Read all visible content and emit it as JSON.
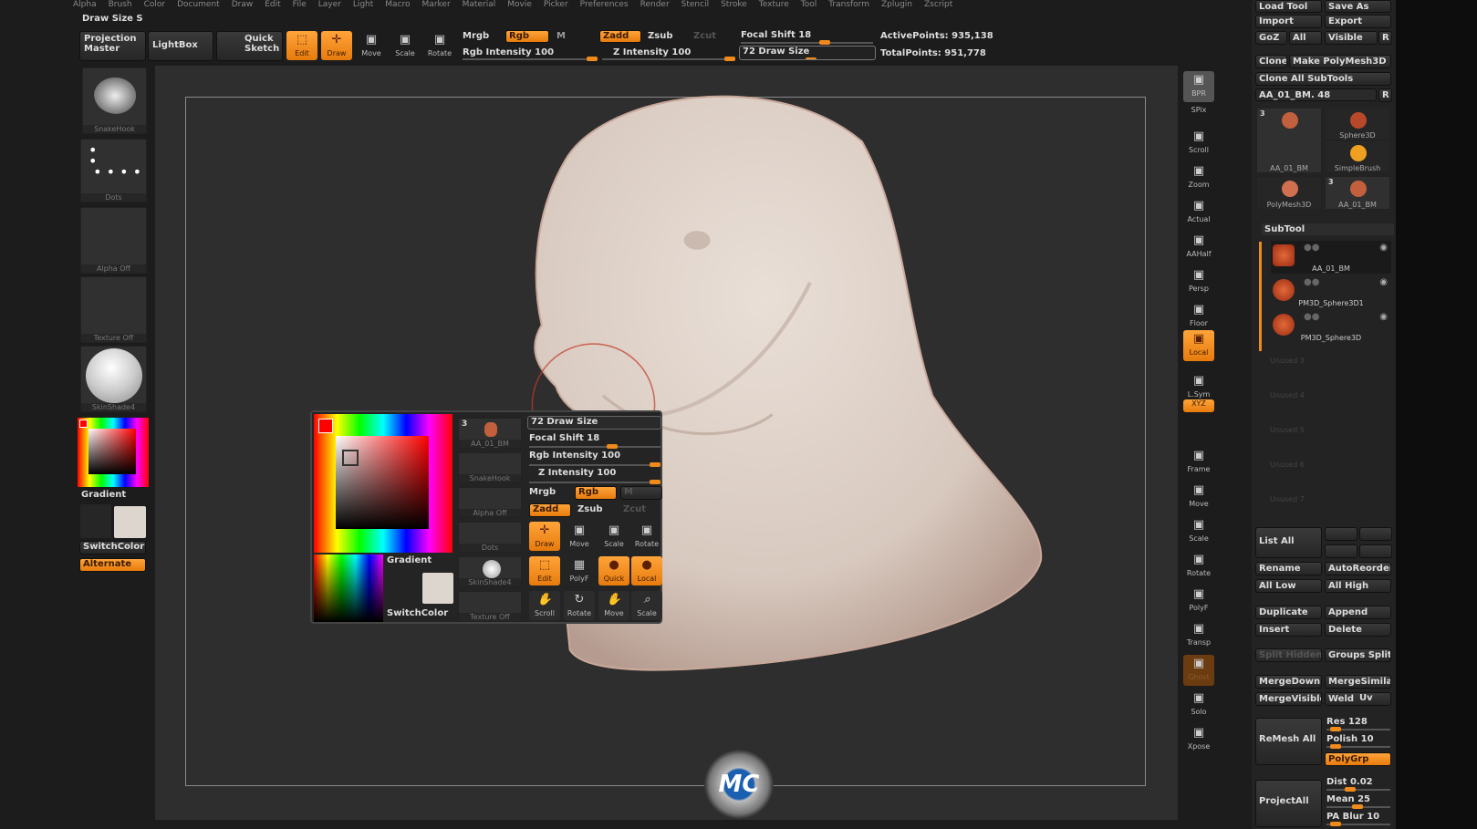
{
  "menu": [
    "Alpha",
    "Brush",
    "Color",
    "Document",
    "Draw",
    "Edit",
    "File",
    "Layer",
    "Light",
    "Macro",
    "Marker",
    "Material",
    "Movie",
    "Picker",
    "Preferences",
    "Render",
    "Stencil",
    "Stroke",
    "Texture",
    "Tool",
    "Transform",
    "Zplugin",
    "Zscript"
  ],
  "status": "Draw Size  S",
  "toolbar": {
    "projection_master": "Projection Master",
    "lightbox": "LightBox",
    "quick_sketch": "Quick Sketch",
    "edit": "Edit",
    "draw": "Draw",
    "move": "Move",
    "scale": "Scale",
    "rotate": "Rotate",
    "mrgb": "Mrgb",
    "rgb": "Rgb",
    "m": "M",
    "zadd": "Zadd",
    "zsub": "Zsub",
    "zcut": "Zcut",
    "rgb_intensity": "Rgb Intensity 100",
    "z_intensity": "Z Intensity 100",
    "focal_shift": "Focal Shift 18",
    "draw_size": "72 Draw Size",
    "active_points": "ActivePoints: 935,138",
    "total_points": "TotalPoints: 951,778"
  },
  "sliders": {
    "rgb_intensity": 100,
    "z_intensity": 100,
    "focal_shift": 18,
    "draw_size": 72
  },
  "left_shelf": {
    "brush": "SnakeHook",
    "stroke": "Dots",
    "alpha": "Alpha Off",
    "texture": "Texture Off",
    "material": "SkinShade4",
    "gradient": "Gradient",
    "switchcolor": "SwitchColor",
    "alternate": "Alternate"
  },
  "popup": {
    "tool": "AA_01_BM",
    "tool_count": "3",
    "brush": "SnakeHook",
    "alpha": "Alpha Off",
    "stroke": "Dots",
    "material": "SkinShade4",
    "texture": "Texture Off",
    "gradient": "Gradient",
    "switchcolor": "SwitchColor",
    "draw_size": "72 Draw Size",
    "focal_shift": "Focal Shift 18",
    "rgb_intensity": "Rgb Intensity 100",
    "z_intensity": "Z Intensity 100",
    "mrgb": "Mrgb",
    "rgb": "Rgb",
    "m": "M",
    "zadd": "Zadd",
    "zsub": "Zsub",
    "zcut": "Zcut",
    "draw": "Draw",
    "move": "Move",
    "scale": "Scale",
    "rotate": "Rotate",
    "edit": "Edit",
    "polyf": "PolyF",
    "quick": "Quick",
    "local": "Local",
    "scroll": "Scroll",
    "rotate2": "Rotate",
    "move2": "Move",
    "scale2": "Scale"
  },
  "right_shelf": [
    "BPR",
    "SPix",
    "Scroll",
    "Zoom",
    "Actual",
    "AAHalf",
    "Persp",
    "Floor",
    "Local",
    "L.Sym",
    "XYZ",
    "Frame",
    "Move",
    "Scale",
    "Rotate",
    "PolyF",
    "Transp",
    "Ghost",
    "Solo",
    "Xpose"
  ],
  "tool_panel": {
    "load_tool": "Load Tool",
    "save_as": "Save As",
    "import": "Import",
    "export": "Export",
    "goz": "GoZ",
    "all": "All",
    "visible": "Visible",
    "r": "R",
    "clone": "Clone",
    "make_polymesh": "Make PolyMesh3D",
    "clone_all": "Clone All SubTools",
    "current_tool": "AA_01_BM. 48",
    "thumbs": [
      {
        "name": "AA_01_BM",
        "count": "3"
      },
      {
        "name": "Sphere3D"
      },
      {
        "name": "SimpleBrush"
      },
      {
        "name": "PolyMesh3D"
      },
      {
        "name": "AA_01_BM",
        "count": "3"
      }
    ]
  },
  "subtool": {
    "title": "SubTool",
    "items": [
      "AA_01_BM",
      "PM3D_Sphere3D1",
      "PM3D_Sphere3D"
    ],
    "unused": [
      "Unused 3",
      "Unused 4",
      "Unused 5",
      "Unused 6",
      "Unused 7"
    ],
    "buttons": {
      "list_all": "List All",
      "rename": "Rename",
      "autoreorder": "AutoReorder",
      "all_low": "All Low",
      "all_high": "All High",
      "duplicate": "Duplicate",
      "append": "Append",
      "insert": "Insert",
      "delete": "Delete",
      "split_hidden": "Split Hidden",
      "groups_split": "Groups Split",
      "mergedown": "MergeDown",
      "mergesimilar": "MergeSimilar",
      "mergevisible": "MergeVisible",
      "weld": "Weld",
      "uv": "Uv",
      "remesh_all": "ReMesh All",
      "res": "Res 128",
      "polish": "Polish 10",
      "polygrp": "PolyGrp",
      "projectall": "ProjectAll",
      "dist": "Dist 0.02",
      "mean": "Mean 25",
      "pa_blur": "PA Blur 10"
    }
  },
  "colors": {
    "accent": "#f08a1a",
    "skin": "#e3d8cf",
    "bg": "#2b2b2b"
  },
  "logo": "MC"
}
